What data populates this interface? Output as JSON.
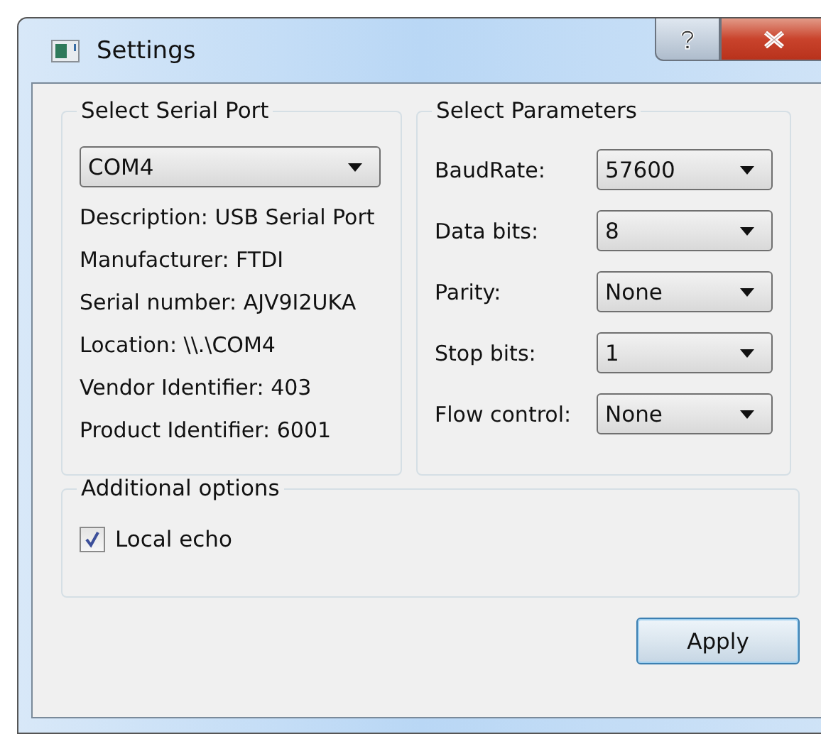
{
  "window": {
    "title": "Settings"
  },
  "serial_port": {
    "title": "Select Serial Port",
    "port": "COM4",
    "info": [
      "Description: USB Serial Port",
      "Manufacturer: FTDI",
      "Serial number: AJV9I2UKA",
      "Location: \\\\.\\COM4",
      "Vendor Identifier: 403",
      "Product Identifier: 6001"
    ]
  },
  "parameters": {
    "title": "Select Parameters",
    "fields": [
      {
        "label": "BaudRate:",
        "value": "57600"
      },
      {
        "label": "Data bits:",
        "value": "8"
      },
      {
        "label": "Parity:",
        "value": "None"
      },
      {
        "label": "Stop bits:",
        "value": "1"
      },
      {
        "label": "Flow control:",
        "value": "None"
      }
    ]
  },
  "additional": {
    "title": "Additional options",
    "options": [
      {
        "label": "Local echo",
        "checked": true
      }
    ]
  },
  "buttons": [
    "Apply"
  ]
}
